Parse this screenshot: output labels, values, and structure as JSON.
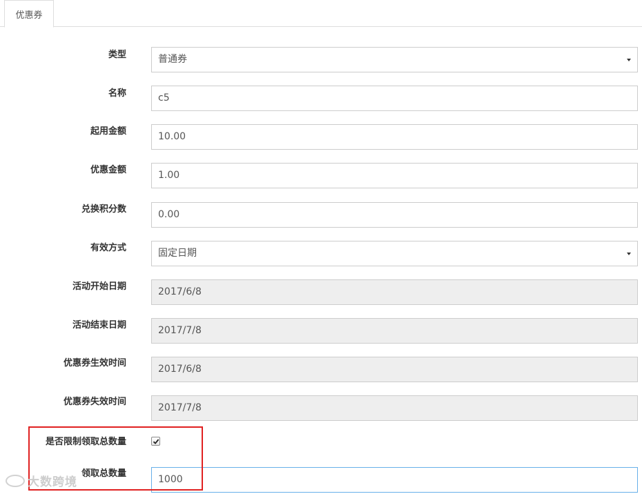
{
  "tab": {
    "label": "优惠券"
  },
  "form": {
    "type": {
      "label": "类型",
      "value": "普通券"
    },
    "name": {
      "label": "名称",
      "value": "c5"
    },
    "min_amount": {
      "label": "起用金额",
      "value": "10.00"
    },
    "discount_amount": {
      "label": "优惠金额",
      "value": "1.00"
    },
    "points": {
      "label": "兑换积分数",
      "value": "0.00"
    },
    "validity_mode": {
      "label": "有效方式",
      "value": "固定日期"
    },
    "activity_start": {
      "label": "活动开始日期",
      "value": "2017/6/8"
    },
    "activity_end": {
      "label": "活动结束日期",
      "value": "2017/7/8"
    },
    "coupon_start": {
      "label": "优惠券生效时间",
      "value": "2017/6/8"
    },
    "coupon_end": {
      "label": "优惠券失效时间",
      "value": "2017/7/8"
    },
    "limit_total": {
      "label": "是否限制领取总数量",
      "checked": true
    },
    "total_quantity": {
      "label": "领取总数量",
      "value": "1000"
    }
  },
  "highlight_color": "#e02020",
  "watermark": {
    "text": "大数跨境"
  }
}
